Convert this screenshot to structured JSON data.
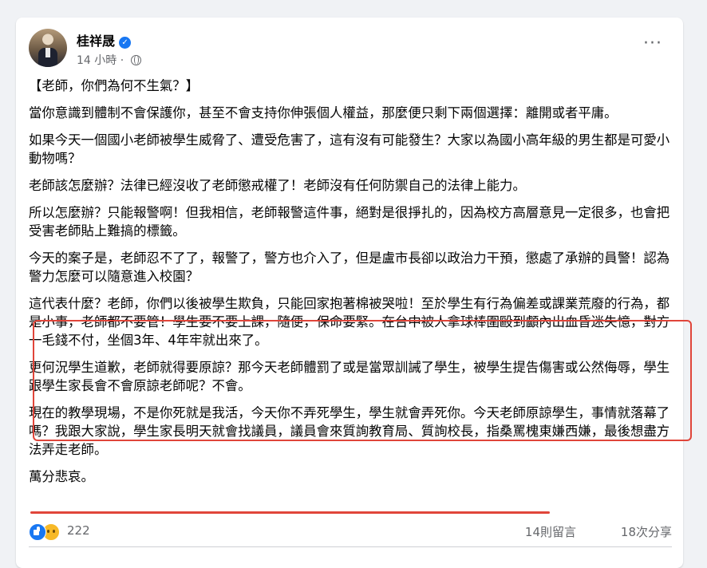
{
  "post": {
    "author": "桂祥晟",
    "time": "14 小時",
    "paragraphs": [
      "【老師，你們為何不生氣？】",
      "當你意識到體制不會保護你，甚至不會支持你伸張個人權益，那麼便只剩下兩個選擇：離開或者平庸。",
      "如果今天一個國小老師被學生威脅了、遭受危害了，這有沒有可能發生？大家以為國小高年級的男生都是可愛小動物嗎？",
      "老師該怎麼辦？法律已經沒收了老師懲戒權了！老師沒有任何防禦自己的法律上能力。",
      "所以怎麼辦？只能報警啊！但我相信，老師報警這件事，絕對是很掙扎的，因為校方高層意見一定很多，也會把受害老師貼上難搞的標籤。",
      "今天的案子是，老師忍不了了，報警了，警方也介入了，但是盧市長卻以政治力干預，懲處了承辦的員警！認為警力怎麼可以隨意進入校園？",
      "這代表什麼？老師，你們以後被學生欺負，只能回家抱著棉被哭啦！至於學生有行為偏差或課業荒廢的行為，都是小事，老師都不要管！學生要不要上課，隨便，保命要緊。在台中被人拿球棒圍毆到顱內出血昏迷失憶，對方一毛錢不付，坐個3年、4年牢就出來了。",
      "更何況學生道歉，老師就得要原諒？那今天老師體罰了或是當眾訓誡了學生，被學生提告傷害或公然侮辱，學生跟學生家長會不會原諒老師呢？不會。",
      "現在的教學現場，不是你死就是我活，今天你不弄死學生，學生就會弄死你。今天老師原諒學生，事情就落幕了嗎？我跟大家說，學生家長明天就會找議員，議員會來質詢教育局、質詢校長，指桑罵槐東嫌西嫌，最後想盡方法弄走老師。",
      "萬分悲哀。"
    ]
  },
  "footer": {
    "reaction_count": "222",
    "comments": "14則留言",
    "shares": "18次分享"
  },
  "icons": {
    "verified": "verified-badge-icon",
    "audience": "globe-icon",
    "more": "more-options-icon",
    "like": "like-reaction-icon",
    "sad": "sad-reaction-icon"
  },
  "colors": {
    "highlight": "#e0453a",
    "verified": "#1877f2",
    "secondary_text": "#65676b"
  }
}
